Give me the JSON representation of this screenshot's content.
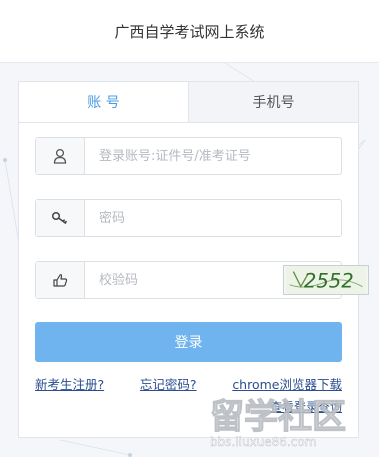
{
  "header": {
    "title": "广西自学考试网上系统"
  },
  "tabs": [
    {
      "label": "账 号",
      "active": true
    },
    {
      "label": "手机号",
      "active": false
    }
  ],
  "form": {
    "account_placeholder": "登录账号:证件号/准考证号",
    "password_placeholder": "密码",
    "captcha_placeholder": "校验码",
    "captcha_text": "2552",
    "user_icon": "user-icon",
    "key_icon": "key-icon",
    "hand_icon": "pointing-hand-icon"
  },
  "login_button": "登录",
  "links": {
    "register": "新考生注册?",
    "forgot": "忘记密码?",
    "chrome": "chrome浏览器下载",
    "query": "查看登录查询"
  },
  "watermark": {
    "logo": "留学社区",
    "url": "bbs.liuxue86.com"
  },
  "colors": {
    "accent": "#4a9ce4",
    "button": "#6fb3ef",
    "link": "#2a4e8f"
  }
}
